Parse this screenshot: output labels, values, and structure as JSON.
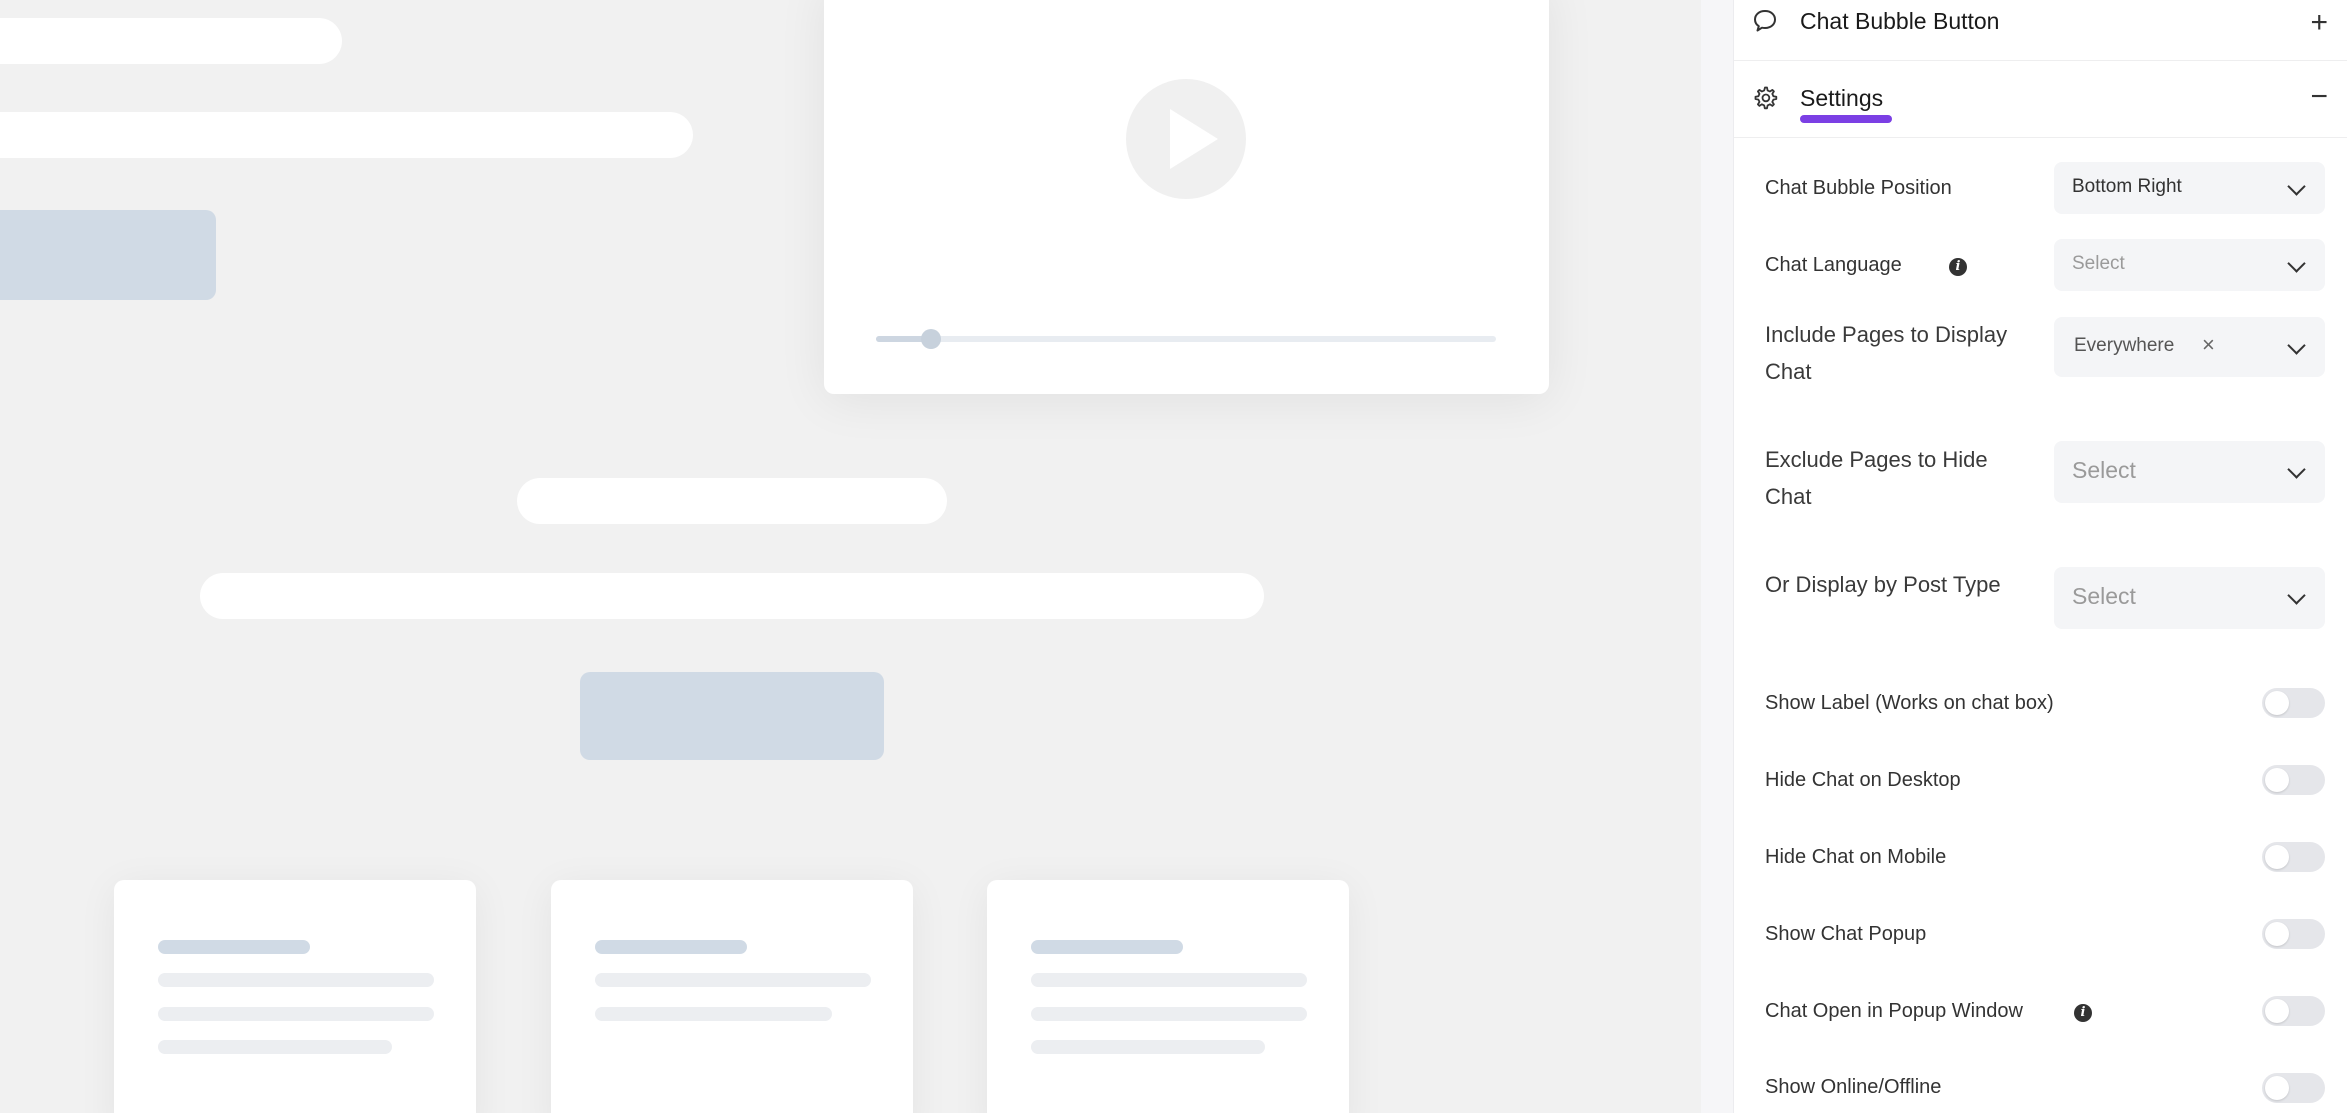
{
  "panel": {
    "chat_bubble_button": {
      "title": "Chat Bubble Button",
      "toggle": "+",
      "icon": "chat-bubble-icon"
    },
    "settings": {
      "title": "Settings",
      "toggle": "−",
      "icon": "gear-icon"
    },
    "fields": {
      "position": {
        "label": "Chat Bubble Position",
        "value": "Bottom Right"
      },
      "language": {
        "label": "Chat Language",
        "placeholder": "Select"
      },
      "include_pages": {
        "label": "Include Pages to Display Chat",
        "chip": "Everywhere",
        "chip_remove": "×"
      },
      "exclude_pages": {
        "label": "Exclude Pages to Hide Chat",
        "placeholder": "Select"
      },
      "post_type": {
        "label": "Or Display by Post Type",
        "placeholder": "Select"
      }
    },
    "toggles": [
      {
        "label": "Show Label (Works on chat box)",
        "on": false
      },
      {
        "label": "Hide Chat on Desktop",
        "on": false
      },
      {
        "label": "Hide Chat on Mobile",
        "on": false
      },
      {
        "label": "Show Chat Popup",
        "on": false
      },
      {
        "label": "Chat Open in Popup Window",
        "on": false
      },
      {
        "label": "Show Online/Offline",
        "on": false
      }
    ],
    "accent_color": "#7b3fe4"
  },
  "preview": {
    "video_progress": 0.06
  }
}
